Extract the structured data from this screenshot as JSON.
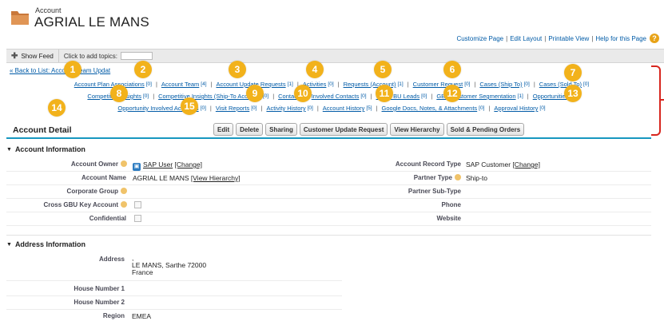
{
  "header": {
    "object_type": "Account",
    "object_name": "AGRIAL LE MANS",
    "top_links": [
      "Customize Page",
      "Edit Layout",
      "Printable View",
      "Help for this Page"
    ],
    "help_icon": "question-icon"
  },
  "feed": {
    "show_feed": "Show Feed",
    "topics_prompt": "Click to add topics:"
  },
  "back_link": "« Back to List: Account Team Updat",
  "related_links": {
    "row1": [
      {
        "label": "Account Plan Associations",
        "count": "[0]"
      },
      {
        "label": "Account Team",
        "count": "[4]"
      },
      {
        "label": "Account Update Requests",
        "count": "[1]"
      },
      {
        "label": "Activities",
        "count": "[0]"
      },
      {
        "label": "Requests (Account)",
        "count": "[1]"
      },
      {
        "label": "Customer Request",
        "count": "[0]"
      },
      {
        "label": "Cases (Ship To)",
        "count": "[0]"
      },
      {
        "label": "Cases (Sold To)",
        "count": "[0]"
      }
    ],
    "row2": [
      {
        "label": "Competitive Insights",
        "count": "[0]"
      },
      {
        "label": "Competitive Insights (Ship-To Account)",
        "count": "[0]"
      },
      {
        "label": "Contacts",
        "count": ""
      },
      {
        "label": "Involved Contacts",
        "count": "[0]"
      },
      {
        "label": "Cross BU Leads",
        "count": "[0]"
      },
      {
        "label": "GBU Customer Segmentation",
        "count": "[1]"
      },
      {
        "label": "Opportunities",
        "count": "[0]"
      }
    ],
    "row3": [
      {
        "label": "Opportunity Involved Accounts",
        "count": "[0]"
      },
      {
        "label": "Visit Reports",
        "count": "[0]"
      },
      {
        "label": "Activity History",
        "count": "[0]"
      },
      {
        "label": "Account History",
        "count": "[5]"
      },
      {
        "label": "Google Docs, Notes, & Attachments",
        "count": "[0]"
      },
      {
        "label": "Approval History",
        "count": "[0]"
      }
    ]
  },
  "badges": [
    "1",
    "2",
    "3",
    "4",
    "5",
    "6",
    "7",
    "8",
    "9",
    "10",
    "11",
    "12",
    "13",
    "14",
    "15"
  ],
  "detail": {
    "title": "Account Detail",
    "buttons": [
      "Edit",
      "Delete",
      "Sharing",
      "Customer Update Request",
      "View Hierarchy",
      "Sold & Pending Orders"
    ]
  },
  "account_info": {
    "heading": "Account Information",
    "owner_label": "Account Owner",
    "owner_value": "SAP User",
    "owner_change": "[Change]",
    "name_label": "Account Name",
    "name_value": "AGRIAL LE MANS",
    "name_hierarchy": "[View Hierarchy]",
    "corporate_group_label": "Corporate Group",
    "cross_gbu_label": "Cross GBU Key Account",
    "confidential_label": "Confidential",
    "record_type_label": "Account Record Type",
    "record_type_value": "SAP Customer",
    "record_type_change": "[Change]",
    "partner_type_label": "Partner Type",
    "partner_type_value": "Ship-to",
    "partner_subtype_label": "Partner Sub-Type",
    "phone_label": "Phone",
    "website_label": "Website"
  },
  "address_info": {
    "heading": "Address Information",
    "address_label": "Address",
    "address_line0": ",",
    "address_line1": "LE MANS, Sarthe 72000",
    "address_line2": "France",
    "house1_label": "House Number 1",
    "house2_label": "House Number 2",
    "region_label": "Region",
    "region_value": "EMEA"
  },
  "colors": {
    "link": "#015ba7",
    "badge": "#f2b21b",
    "bracket": "#d7261e",
    "section_rule": "#1797c0"
  }
}
